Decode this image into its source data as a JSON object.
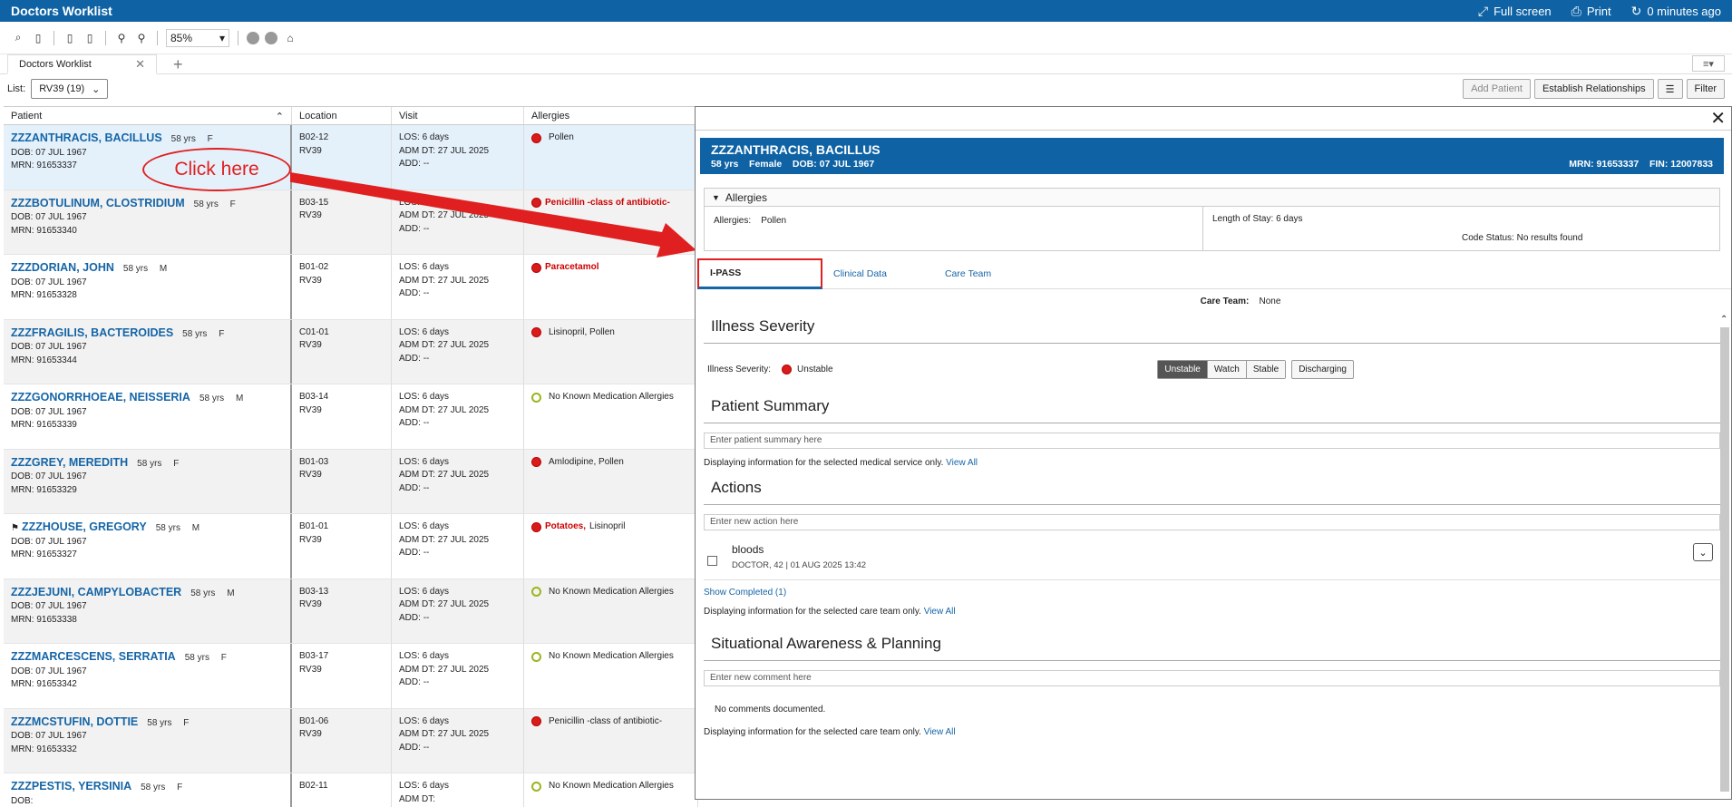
{
  "titlebar": {
    "title": "Doctors Worklist",
    "fullscreen": "Full screen",
    "print": "Print",
    "refresh": "0 minutes ago"
  },
  "toolbar": {
    "zoom": "85%"
  },
  "tabs": [
    {
      "label": "Doctors Worklist"
    }
  ],
  "listbar": {
    "label": "List:",
    "list_value": "RV39 (19)",
    "add_patient": "Add Patient",
    "establish": "Establish Relationships",
    "filter": "Filter"
  },
  "grid": {
    "headers": [
      "Patient",
      "Location",
      "Visit",
      "Allergies"
    ],
    "rows": [
      {
        "name": "ZZZANTHRACIS, BACILLUS",
        "age": "58 yrs",
        "sex": "F",
        "dob": "07 JUL 1967",
        "mrn": "91653337",
        "bed": "B02-12",
        "unit": "RV39",
        "los": "6 days",
        "adm": "27 JUL 2025",
        "add": "--",
        "allergy_red": "",
        "allergy": "Pollen",
        "dot": "red"
      },
      {
        "name": "ZZZBOTULINUM, CLOSTRIDIUM",
        "age": "58 yrs",
        "sex": "F",
        "dob": "07 JUL 1967",
        "mrn": "91653340",
        "bed": "B03-15",
        "unit": "RV39",
        "los": "6 days",
        "adm": "27 JUL 2025",
        "add": "--",
        "allergy_red": "Penicillin -class of antibiotic-",
        "allergy": "",
        "dot": "red"
      },
      {
        "name": "ZZZDORIAN, JOHN",
        "age": "58 yrs",
        "sex": "M",
        "dob": "07 JUL 1967",
        "mrn": "91653328",
        "bed": "B01-02",
        "unit": "RV39",
        "los": "6 days",
        "adm": "27 JUL 2025",
        "add": "--",
        "allergy_red": "Paracetamol",
        "allergy": "",
        "dot": "red"
      },
      {
        "name": "ZZZFRAGILIS, BACTEROIDES",
        "age": "58 yrs",
        "sex": "F",
        "dob": "07 JUL 1967",
        "mrn": "91653344",
        "bed": "C01-01",
        "unit": "RV39",
        "los": "6 days",
        "adm": "27 JUL 2025",
        "add": "--",
        "allergy_red": "",
        "allergy": "Lisinopril, Pollen",
        "dot": "red"
      },
      {
        "name": "ZZZGONORRHOEAE, NEISSERIA",
        "age": "58 yrs",
        "sex": "M",
        "dob": "07 JUL 1967",
        "mrn": "91653339",
        "bed": "B03-14",
        "unit": "RV39",
        "los": "6 days",
        "adm": "27 JUL 2025",
        "add": "--",
        "allergy_red": "",
        "allergy": "No Known Medication Allergies",
        "dot": "green"
      },
      {
        "name": "ZZZGREY, MEREDITH",
        "age": "58 yrs",
        "sex": "F",
        "dob": "07 JUL 1967",
        "mrn": "91653329",
        "bed": "B01-03",
        "unit": "RV39",
        "los": "6 days",
        "adm": "27 JUL 2025",
        "add": "--",
        "allergy_red": "",
        "allergy": "Amlodipine, Pollen",
        "dot": "red"
      },
      {
        "name": "ZZZHOUSE, GREGORY",
        "age": "58 yrs",
        "sex": "M",
        "dob": "07 JUL 1967",
        "mrn": "91653327",
        "bed": "B01-01",
        "unit": "RV39",
        "los": "6 days",
        "adm": "27 JUL 2025",
        "add": "--",
        "allergy_red": "Potatoes,",
        "allergy": "Lisinopril",
        "dot": "red"
      },
      {
        "name": "ZZZJEJUNI, CAMPYLOBACTER",
        "age": "58 yrs",
        "sex": "M",
        "dob": "07 JUL 1967",
        "mrn": "91653338",
        "bed": "B03-13",
        "unit": "RV39",
        "los": "6 days",
        "adm": "27 JUL 2025",
        "add": "--",
        "allergy_red": "",
        "allergy": "No Known Medication Allergies",
        "dot": "green"
      },
      {
        "name": "ZZZMARCESCENS, SERRATIA",
        "age": "58 yrs",
        "sex": "F",
        "dob": "07 JUL 1967",
        "mrn": "91653342",
        "bed": "B03-17",
        "unit": "RV39",
        "los": "6 days",
        "adm": "27 JUL 2025",
        "add": "--",
        "allergy_red": "",
        "allergy": "No Known Medication Allergies",
        "dot": "green"
      },
      {
        "name": "ZZZMCSTUFIN, DOTTIE",
        "age": "58 yrs",
        "sex": "F",
        "dob": "07 JUL 1967",
        "mrn": "91653332",
        "bed": "B01-06",
        "unit": "RV39",
        "los": "6 days",
        "adm": "27 JUL 2025",
        "add": "--",
        "allergy_red": "",
        "allergy": "Penicillin -class of antibiotic-",
        "dot": "red"
      },
      {
        "name": "ZZZPESTIS, YERSINIA",
        "age": "58 yrs",
        "sex": "F",
        "dob": "",
        "mrn": "",
        "bed": "B02-11",
        "unit": "",
        "los": "6 days",
        "adm": "",
        "add": "",
        "allergy_red": "",
        "allergy": "No Known Medication Allergies",
        "dot": "green"
      }
    ],
    "labels": {
      "dob": "DOB:",
      "mrn": "MRN:",
      "los": "LOS:",
      "adm": "ADM DT:",
      "add": "ADD:"
    }
  },
  "annotation": {
    "text": "Click here"
  },
  "panel": {
    "banner": {
      "name": "ZZZANTHRACIS, BACILLUS",
      "age": "58 yrs",
      "sex": "Female",
      "dob_label": "DOB:",
      "dob": "07 JUL 1967",
      "mrn_label": "MRN:",
      "mrn": "91653337",
      "fin_label": "FIN:",
      "fin": "12007833"
    },
    "allergies": {
      "header": "Allergies",
      "label": "Allergies:",
      "value": "Pollen",
      "los_label": "Length of Stay:",
      "los": "6 days",
      "code_label": "Code Status:",
      "code": "No results found"
    },
    "tabs": [
      "I-PASS",
      "Clinical Data",
      "Care Team"
    ],
    "care_team_label": "Care Team:",
    "care_team": "None",
    "illness": {
      "title": "Illness Severity",
      "label": "Illness Severity:",
      "value": "Unstable",
      "options": [
        "Unstable",
        "Watch",
        "Stable"
      ],
      "discharging": "Discharging"
    },
    "summary": {
      "title": "Patient Summary",
      "placeholder": "Enter patient summary here",
      "info": "Displaying information for the selected medical service only.",
      "link": "View All"
    },
    "actions": {
      "title": "Actions",
      "placeholder": "Enter new action here",
      "item_title": "bloods",
      "item_sub": "DOCTOR, 42 | 01 AUG 2025 13:42",
      "show_completed": "Show Completed (1)",
      "info": "Displaying information for the selected care team only.",
      "link": "View All"
    },
    "situational": {
      "title": "Situational Awareness & Planning",
      "placeholder": "Enter new comment here",
      "none": "No comments documented.",
      "info": "Displaying information for the selected care team only.",
      "link": "View All"
    }
  }
}
